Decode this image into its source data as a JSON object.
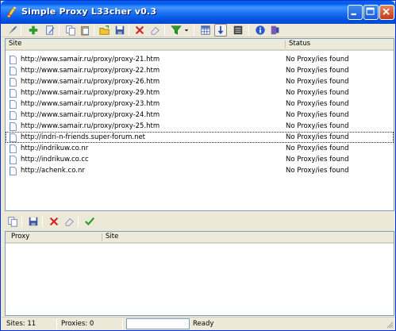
{
  "window": {
    "title": "Simple Proxy L33cher v0.3"
  },
  "toolbar": {
    "icons": [
      "launch-icon",
      "add-icon",
      "edit-icon",
      "copy-icon",
      "paste-icon",
      "open-icon",
      "save-icon",
      "delete-icon",
      "eraser-icon",
      "filter-icon",
      "filter-dropdown-icon",
      "grid-icon",
      "download-arrow-icon",
      "list-icon",
      "info-icon",
      "exit-icon"
    ]
  },
  "sites_list": {
    "columns": [
      "Site",
      "Status"
    ],
    "rows": [
      {
        "site": "http://www.samair.ru/proxy/proxy-21.htm",
        "status": "No Proxy/ies found"
      },
      {
        "site": "http://www.samair.ru/proxy/proxy-22.htm",
        "status": "No Proxy/ies found"
      },
      {
        "site": "http://www.samair.ru/proxy/proxy-26.htm",
        "status": "No Proxy/ies found"
      },
      {
        "site": "http://www.samair.ru/proxy/proxy-29.htm",
        "status": "No Proxy/ies found"
      },
      {
        "site": "http://www.samair.ru/proxy/proxy-23.htm",
        "status": "No Proxy/ies found"
      },
      {
        "site": "http://www.samair.ru/proxy/proxy-24.htm",
        "status": "No Proxy/ies found"
      },
      {
        "site": "http://www.samair.ru/proxy/proxy-25.htm",
        "status": "No Proxy/ies found"
      },
      {
        "site": "http://indri-n-friends.super-forum.net",
        "status": "No Proxy/ies found"
      },
      {
        "site": "http://indrikuw.co.nr",
        "status": "No Proxy/ies found"
      },
      {
        "site": "http://indrikuw.co.cc",
        "status": "No Proxy/ies found"
      },
      {
        "site": "http://achenk.co.nr",
        "status": "No Proxy/ies found"
      }
    ]
  },
  "proxies_list": {
    "columns": [
      "Proxy",
      "Site"
    ],
    "rows": []
  },
  "statusbar": {
    "sites": "Sites: 11",
    "proxies": "Proxies: 0",
    "progress_value": "",
    "state": "Ready"
  },
  "colors": {
    "title_blue": "#0058ee",
    "window_face": "#ece9d8",
    "list_border": "#7f9db9",
    "delete_red": "#d42020",
    "ok_green": "#2a9a2a"
  }
}
